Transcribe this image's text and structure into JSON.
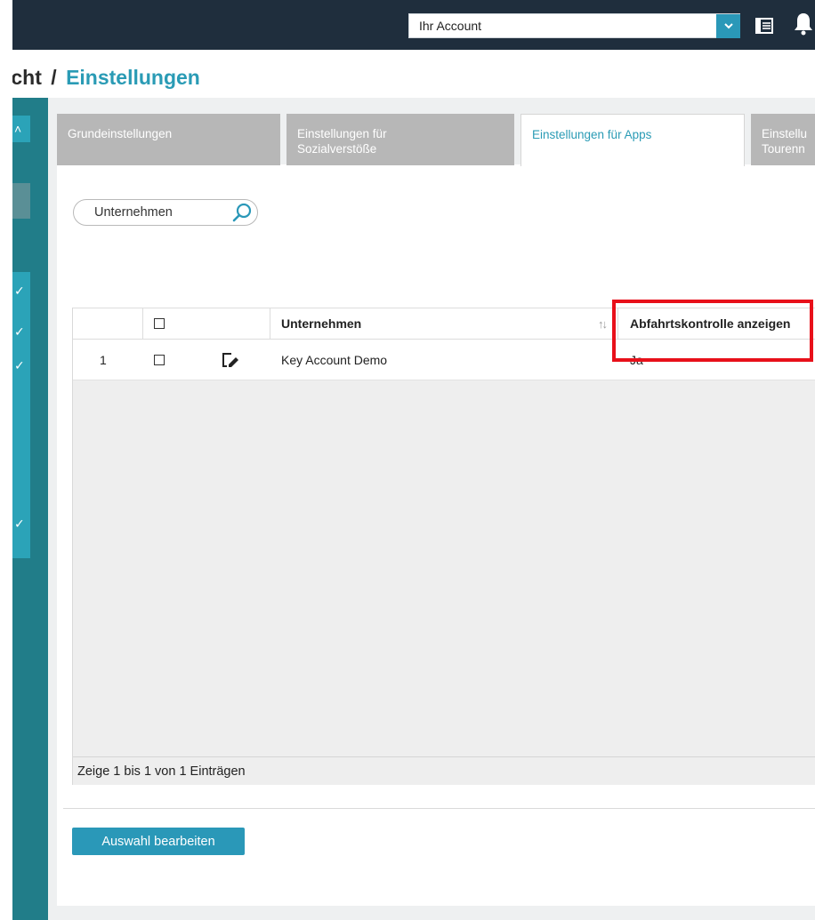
{
  "header": {
    "account_select": "Ihr Account"
  },
  "breadcrumb": {
    "prev": "icht",
    "separator": "/",
    "current": "Einstellungen"
  },
  "tabs": [
    {
      "label": "Grundeinstellungen",
      "active": false
    },
    {
      "label_line1": "Einstellungen für",
      "label_line2": "Sozialverstöße",
      "active": false
    },
    {
      "label": "Einstellungen für Apps",
      "active": true
    },
    {
      "label_line1": "Einstellu",
      "label_line2": "Tourenn",
      "active": false
    }
  ],
  "search": {
    "placeholder": "Unternehmen"
  },
  "table": {
    "columns": [
      "",
      "",
      "",
      "Unternehmen",
      "Abfahrtskontrolle anzeigen"
    ],
    "rows": [
      {
        "index": "1",
        "company": "Key Account Demo",
        "departure_check": "Ja"
      }
    ],
    "footer": "Zeige 1 bis 1 von 1 Einträgen"
  },
  "actions": {
    "edit_selection": "Auswahl bearbeiten"
  },
  "colors": {
    "accent": "#2a98b8",
    "topbar": "#1f2e3d",
    "rail": "#217d89",
    "highlight": "#e8101a"
  }
}
